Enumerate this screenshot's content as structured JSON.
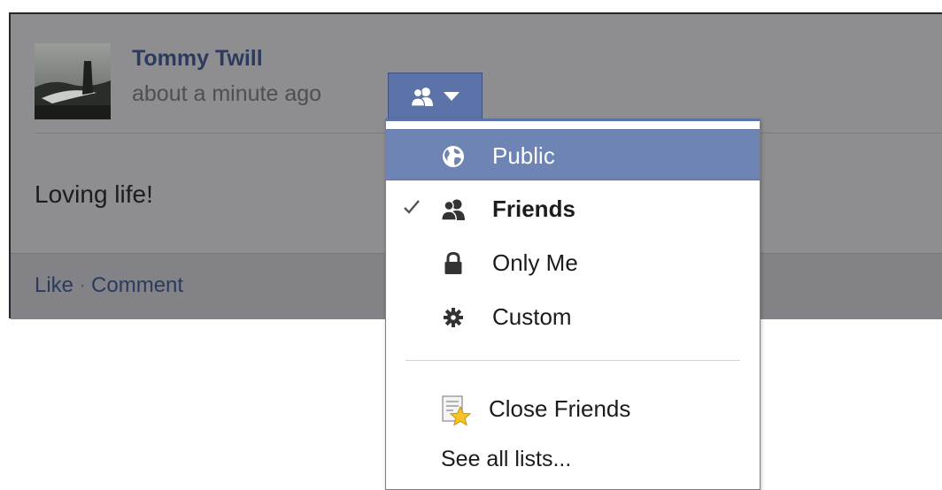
{
  "post": {
    "author": "Tommy Twill",
    "timestamp": "about a minute ago",
    "privacy_icon": "friends-icon",
    "body": "Loving life!",
    "actions": {
      "like": "Like",
      "separator": "·",
      "comment": "Comment"
    }
  },
  "privacy_menu": {
    "options": [
      {
        "label": "Public",
        "icon": "globe-icon",
        "highlighted": true,
        "checked": false
      },
      {
        "label": "Friends",
        "icon": "friends-icon",
        "highlighted": false,
        "checked": true
      },
      {
        "label": "Only Me",
        "icon": "lock-icon",
        "highlighted": false,
        "checked": false
      },
      {
        "label": "Custom",
        "icon": "gear-icon",
        "highlighted": false,
        "checked": false
      }
    ],
    "lists": [
      {
        "label": "Close Friends",
        "icon": "close-friends-star-icon"
      }
    ],
    "see_all": "See all lists..."
  },
  "colors": {
    "accent": "#5b73a8",
    "highlight": "#6d84b4",
    "link": "#2b3a5e"
  }
}
